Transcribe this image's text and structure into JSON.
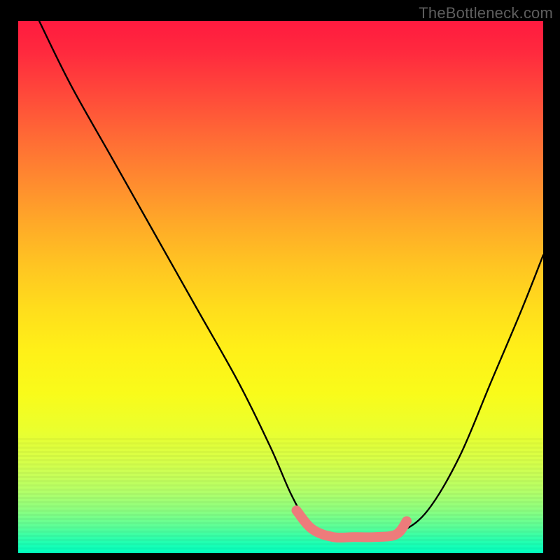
{
  "watermark": "TheBottleneck.com",
  "chart_data": {
    "type": "line",
    "title": "",
    "xlabel": "",
    "ylabel": "",
    "xlim": [
      0,
      100
    ],
    "ylim": [
      0,
      100
    ],
    "series": [
      {
        "name": "main-curve",
        "x": [
          4,
          10,
          18,
          26,
          34,
          42,
          48,
          52,
          55,
          58,
          62,
          66,
          70,
          73,
          78,
          84,
          90,
          96,
          100
        ],
        "values": [
          100,
          88,
          74,
          60,
          46,
          32,
          20,
          11,
          6,
          3.5,
          3,
          3,
          3.2,
          4,
          8,
          18,
          32,
          46,
          56
        ]
      },
      {
        "name": "highlight-band",
        "x": [
          53,
          56,
          60,
          64,
          68,
          72,
          74
        ],
        "values": [
          8,
          4.5,
          3,
          3,
          3,
          3.5,
          6
        ]
      }
    ],
    "colors": {
      "gradient_top": "#ff1a3f",
      "gradient_mid": "#ffdd1c",
      "gradient_bottom": "#00ffc0",
      "curve": "#000000",
      "highlight": "#ed7b7b"
    }
  }
}
